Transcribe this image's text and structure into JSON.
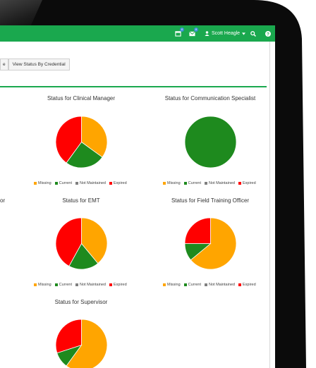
{
  "navbar": {
    "user_name": "Scott Heagle",
    "calendar_badge": "8",
    "mail_badge": "8"
  },
  "toolbar": {
    "partial_button": "e",
    "view_status_label": "View Status By Credential"
  },
  "partial_title_left": "or",
  "legend_labels": [
    "Missing",
    "Current",
    "Not Maintained",
    "Expired"
  ],
  "colors": {
    "missing": "#ffa500",
    "current": "#1e8a1e",
    "not_maintained": "#808080",
    "expired": "#ff0000",
    "navbar": "#1aa84e"
  },
  "charts": [
    {
      "title": "Status for Clinical Manager"
    },
    {
      "title": "Status for Communication Specialist"
    },
    {
      "title": "Status for EMT"
    },
    {
      "title": "Status for Field Training Officer"
    },
    {
      "title": "Status for Supervisor"
    }
  ],
  "chart_data": [
    {
      "type": "pie",
      "title": "Status for Clinical Manager",
      "categories": [
        "Missing",
        "Current",
        "Not Maintained",
        "Expired"
      ],
      "values": [
        35,
        25,
        0,
        40
      ]
    },
    {
      "type": "pie",
      "title": "Status for Communication Specialist",
      "categories": [
        "Missing",
        "Current",
        "Not Maintained",
        "Expired"
      ],
      "values": [
        0,
        100,
        0,
        0
      ]
    },
    {
      "type": "pie",
      "title": "Status for EMT",
      "categories": [
        "Missing",
        "Current",
        "Not Maintained",
        "Expired"
      ],
      "values": [
        39,
        19,
        0,
        42
      ]
    },
    {
      "type": "pie",
      "title": "Status for Field Training Officer",
      "categories": [
        "Missing",
        "Current",
        "Not Maintained",
        "Expired"
      ],
      "values": [
        64,
        11,
        0,
        25
      ]
    },
    {
      "type": "pie",
      "title": "Status for Supervisor",
      "categories": [
        "Missing",
        "Current",
        "Not Maintained",
        "Expired"
      ],
      "values": [
        60,
        10,
        0,
        30
      ]
    }
  ]
}
